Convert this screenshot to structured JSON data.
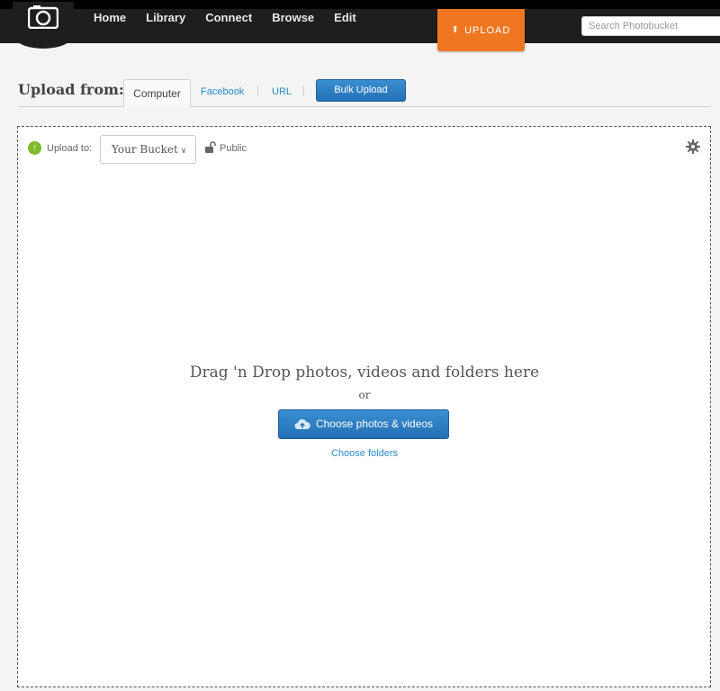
{
  "nav": {
    "items": [
      "Home",
      "Library",
      "Connect",
      "Browse",
      "Edit"
    ],
    "upload_label": "UPLOAD",
    "search_placeholder": "Search Photobucket"
  },
  "upload_from": {
    "label": "Upload from:",
    "tabs": [
      "Computer",
      "Facebook",
      "URL"
    ],
    "bulk_label": "Bulk Upload"
  },
  "dropzone": {
    "upload_to_label": "Upload to:",
    "bucket_value": "Your Bucket",
    "privacy_label": "Public",
    "drag_text": "Drag 'n Drop photos, videos and folders here",
    "or_text": "or",
    "choose_label": "Choose photos & videos",
    "choose_folders_label": "Choose folders"
  },
  "icons": {
    "logo": "camera-logo-icon",
    "upload_arrow": "arrow-up-icon",
    "upload_to": "upload-circle-icon",
    "lock": "unlock-icon",
    "gear": "gear-icon",
    "cloud": "cloud-upload-icon"
  },
  "colors": {
    "topbar": "#1e1e1e",
    "upload_orange": "#ef7722",
    "button_blue": "#2f80c4",
    "link_blue": "#2a8bc9",
    "green": "#7dbb2e"
  }
}
